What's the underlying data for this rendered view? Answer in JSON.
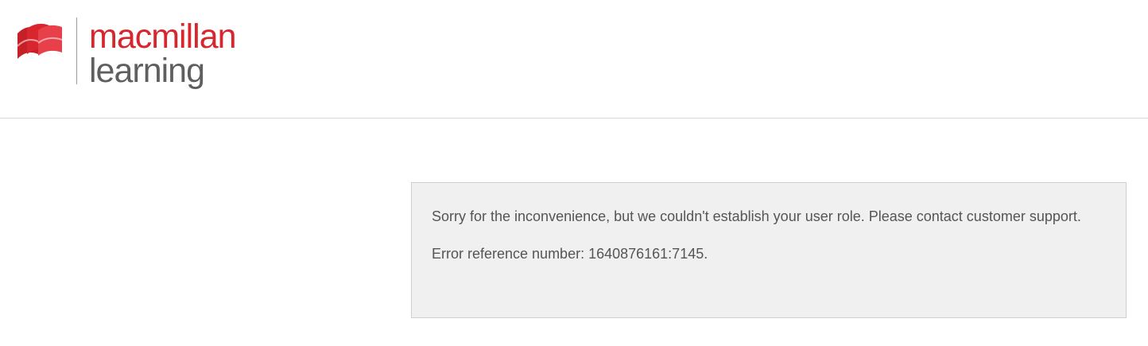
{
  "colors": {
    "brand_red": "#d8262f",
    "brand_gray": "#5f5f5f",
    "panel_bg": "#f0f0f0",
    "text": "#555555"
  },
  "header": {
    "logo": {
      "icon": "macmillan-flag-logo-icon",
      "word_top": "macmillan",
      "word_bottom": "learning"
    }
  },
  "error": {
    "message": "Sorry for the inconvenience, but we couldn't establish your user role. Please contact customer support.",
    "reference": "Error reference number: 1640876161:7145."
  }
}
